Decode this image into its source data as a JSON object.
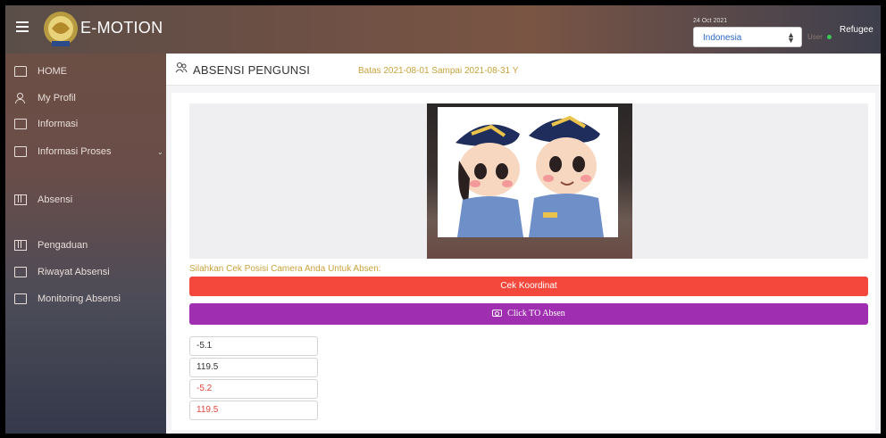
{
  "topbar": {
    "brand": "E-MOTION",
    "date": "24 Oct 2021",
    "country_select": "Indonesia",
    "user_small": "User",
    "user_name": "Refugee"
  },
  "sidebar": {
    "items": [
      {
        "label": "HOME",
        "icon": "home-icon"
      },
      {
        "label": "My Profil",
        "icon": "user-icon"
      },
      {
        "label": "Informasi",
        "icon": "document-icon"
      },
      {
        "label": "Informasi Proses",
        "icon": "mail-icon"
      },
      {
        "label": "Absensi",
        "icon": "map-icon"
      },
      {
        "label": "Pengaduan",
        "icon": "map-icon"
      },
      {
        "label": "Riwayat Absensi",
        "icon": "document-icon"
      },
      {
        "label": "Monitoring Absensi",
        "icon": "monitor-icon"
      }
    ]
  },
  "header": {
    "title": "ABSENSI PENGUNSI",
    "subtitle": "Batas 2021-08-01 Sampai 2021-08-31 Y"
  },
  "main": {
    "camera_prompt": "Silahkan Cek Posisi Camera Anda Untuk Absen:",
    "cek_button": "Cek Koordinat",
    "absen_button": "Click TO Absen",
    "coordinates": [
      "-5.1",
      "119.5",
      "-5.2",
      "119.5"
    ]
  },
  "colors": {
    "cek_button": "#f5483c",
    "absen_button": "#9f2fb0",
    "accent_text": "#c9a23c"
  }
}
